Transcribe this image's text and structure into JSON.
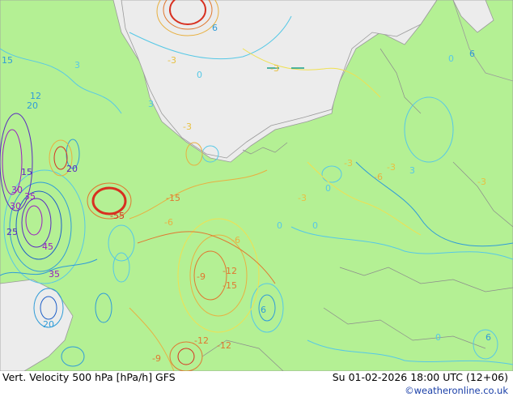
{
  "map": {
    "title": "Vert. Velocity 500 hPa [hPa/h] GFS",
    "valid_time": "Su 01-02-2026 18:00 UTC (12+06)",
    "credit": "©weatheronline.co.uk",
    "colors": {
      "sea": "#ececec",
      "land": "#b4f094",
      "coast": "#9a9a9a",
      "positive_contours": [
        "#56c8e6",
        "#2f9cd8",
        "#1e5fc8",
        "#5a2ac0",
        "#9a1ec0"
      ],
      "negative_contours": [
        "#f0e050",
        "#e8b040",
        "#e07830",
        "#d83020"
      ]
    },
    "contour_labels": [
      "3",
      "3",
      "3",
      "-3",
      "-3",
      "-3",
      "-3",
      "-3",
      "-3",
      "-3",
      "0",
      "0",
      "0",
      "0",
      "0",
      "0",
      "6",
      "6",
      "6",
      "6",
      "-6",
      "-6",
      "-6",
      "-9",
      "-9",
      "12",
      "20",
      "20",
      "20",
      "15",
      "15",
      "-15",
      "-15",
      "30",
      "30",
      "35",
      "35",
      "25",
      "45",
      "-55",
      "-12",
      "-12",
      "-12"
    ]
  }
}
